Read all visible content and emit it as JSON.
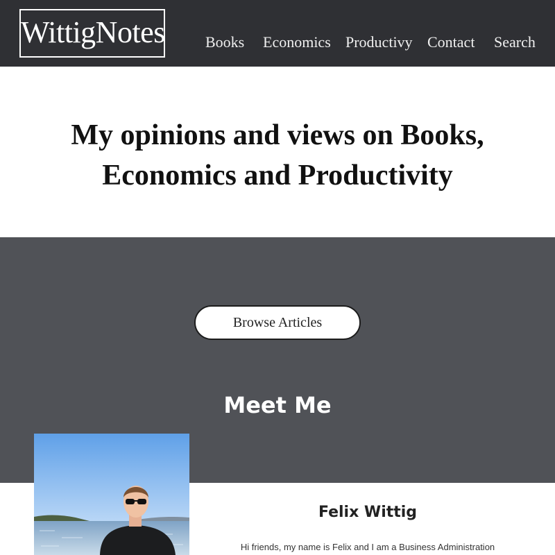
{
  "header": {
    "logo": "WittigNotes",
    "nav": [
      {
        "label": "Books"
      },
      {
        "label": "Economics"
      },
      {
        "label": "Productivy"
      },
      {
        "label": "Contact"
      },
      {
        "label": "Search"
      }
    ]
  },
  "hero": {
    "title_line1": "My opinions and views on Books,",
    "title_line2": "Economics and Productivity"
  },
  "cta": {
    "browse_label": "Browse Articles"
  },
  "meet": {
    "title": "Meet Me",
    "name": "Felix Wittig",
    "intro": "Hi friends, my name is Felix and I am a Business Administration"
  },
  "colors": {
    "header_bg": "#2f3034",
    "band_bg": "#505257",
    "text_dark": "#111111",
    "accent_white": "#ffffff"
  }
}
